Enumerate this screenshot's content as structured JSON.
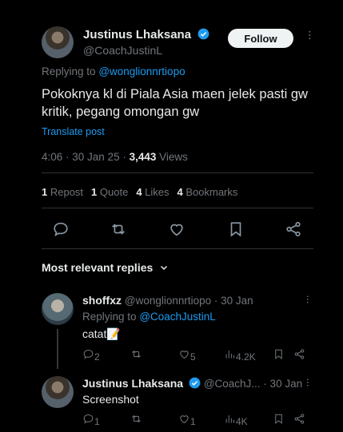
{
  "main_post": {
    "author_name": "Justinus Lhaksana",
    "author_handle": "@CoachJustinL",
    "follow_label": "Follow",
    "replying_prefix": "Replying to",
    "replying_to": "@wonglionnrtiopo",
    "text": "Pokoknya kl di Piala Asia maen jelek pasti gw kritik, pegang omongan gw",
    "translate_label": "Translate post",
    "timestamp": "4:06 · 30 Jan 25 · ",
    "views_count": "3,443",
    "views_label": " Views",
    "stats": {
      "reposts_count": "1",
      "reposts_label": " Repost",
      "quotes_count": "1",
      "quotes_label": " Quote",
      "likes_count": "4",
      "likes_label": " Likes",
      "bookmarks_count": "4",
      "bookmarks_label": " Bookmarks"
    }
  },
  "replies_sort_label": "Most relevant replies",
  "replies": [
    {
      "name": "shoffxz",
      "handle": "@wonglionnrtiopo · 30 Jan",
      "replying_prefix": "Replying to",
      "replying_to": "@CoachJustinL",
      "text": "catat📝",
      "replies": "2",
      "reposts": "",
      "likes": "5",
      "views": "4.2K"
    },
    {
      "name": "Justinus Lhaksana",
      "handle": "@CoachJ... · 30 Jan",
      "text": "Screenshot",
      "replies": "1",
      "reposts": "",
      "likes": "1",
      "views": "4K"
    }
  ],
  "colors": {
    "accent": "#1d9bf0",
    "background": "#000000",
    "muted": "#71767b"
  }
}
